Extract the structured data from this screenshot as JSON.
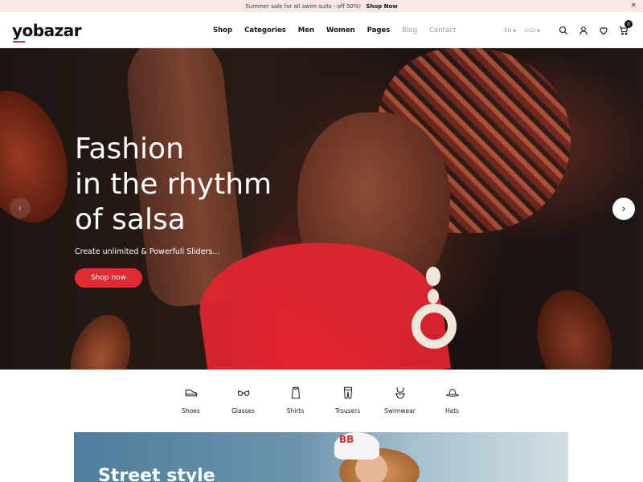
{
  "announcement": {
    "message": "Summer sale for all swim suits - off 50%!",
    "cta": "Shop Now",
    "close": "×"
  },
  "header": {
    "logo": "yobazar",
    "nav": [
      {
        "label": "Shop"
      },
      {
        "label": "Categories"
      },
      {
        "label": "Men"
      },
      {
        "label": "Women"
      },
      {
        "label": "Pages"
      },
      {
        "label": "Blog"
      },
      {
        "label": "Contact"
      }
    ],
    "language": "EN",
    "currency": "USD",
    "cart_count": "0",
    "icons": [
      "search-icon",
      "user-icon",
      "heart-icon",
      "cart-icon"
    ]
  },
  "hero": {
    "title_lines": [
      "Fashion",
      "in the rhythm",
      "of salsa"
    ],
    "subtitle": "Create unlimited & Powerfull Sliders...",
    "button": "Shop now",
    "prev_arrow": "‹",
    "next_arrow": "›",
    "accent_color": "#e02b34"
  },
  "categories": [
    {
      "label": "Shoes",
      "icon": "shoe-icon"
    },
    {
      "label": "Glasses",
      "icon": "glasses-icon"
    },
    {
      "label": "Shirts",
      "icon": "shirt-icon"
    },
    {
      "label": "Trousers",
      "icon": "trousers-icon"
    },
    {
      "label": "Swimwear",
      "icon": "swimwear-icon"
    },
    {
      "label": "Hats",
      "icon": "hat-icon"
    }
  ],
  "promo": {
    "title": "Street style",
    "cap_text": "BB"
  }
}
